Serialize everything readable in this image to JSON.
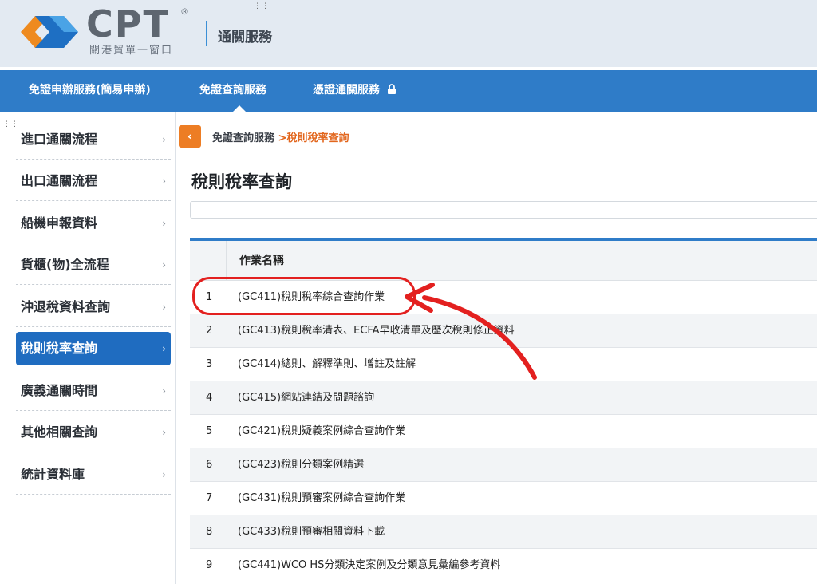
{
  "header": {
    "logo_text": "CPT",
    "logo_registered": "®",
    "logo_subtitle": "關港貿單一窗口",
    "service_title": "通關服務"
  },
  "nav": {
    "items": [
      {
        "label": "免證申辦服務(簡易申辦)"
      },
      {
        "label": "免證查詢服務",
        "active": true
      },
      {
        "label": "憑證通關服務",
        "icon": "lock-icon"
      }
    ]
  },
  "sidebar": {
    "items": [
      {
        "label": "進口通關流程",
        "chevron": "›"
      },
      {
        "label": "出口通關流程",
        "chevron": "›"
      },
      {
        "label": "船機申報資料",
        "chevron": "›"
      },
      {
        "label": "貨櫃(物)全流程",
        "chevron": "›"
      },
      {
        "label": "沖退稅資料查詢",
        "chevron": "›"
      },
      {
        "label": "稅則稅率查詢",
        "chevron": "›",
        "active": true
      },
      {
        "label": "廣義通關時間",
        "chevron": "›"
      },
      {
        "label": "其他相關查詢",
        "chevron": "›"
      },
      {
        "label": "統計資料庫",
        "chevron": "›"
      }
    ]
  },
  "main": {
    "breadcrumb": {
      "parent": "免證查詢服務",
      "separator": " >",
      "current": "稅則稅率查詢"
    },
    "title": "稅則稅率查詢",
    "table": {
      "header": "作業名稱",
      "rows": [
        {
          "idx": "1",
          "name": "(GC411)稅則稅率綜合查詢作業"
        },
        {
          "idx": "2",
          "name": "(GC413)稅則稅率清表、ECFA早收清單及歷次稅則修正資料"
        },
        {
          "idx": "3",
          "name": "(GC414)總則、解釋準則、增註及註解"
        },
        {
          "idx": "4",
          "name": "(GC415)網站連結及問題諮詢"
        },
        {
          "idx": "5",
          "name": "(GC421)稅則疑義案例綜合查詢作業"
        },
        {
          "idx": "6",
          "name": "(GC423)稅則分類案例精選"
        },
        {
          "idx": "7",
          "name": "(GC431)稅則預審案例綜合查詢作業"
        },
        {
          "idx": "8",
          "name": "(GC433)稅則預審相關資料下載"
        },
        {
          "idx": "9",
          "name": "(GC441)WCO HS分類決定案例及分類意見彙編參考資料"
        }
      ]
    }
  },
  "colors": {
    "nav_blue": "#2f7cc8",
    "active_blue": "#1f6cc0",
    "accent_orange": "#ed7d24",
    "annotation_red": "#e3201f"
  }
}
